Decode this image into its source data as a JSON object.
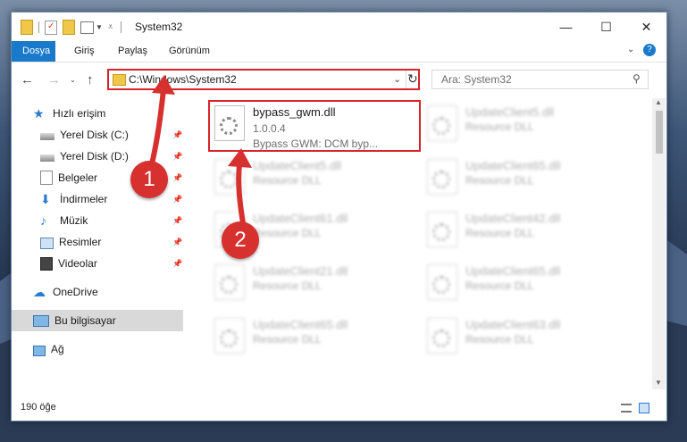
{
  "window": {
    "title": "System32",
    "minimize_glyph": "—",
    "maximize_glyph": "☐",
    "close_glyph": "✕"
  },
  "ribbon": {
    "tabs": [
      "Dosya",
      "Giriş",
      "Paylaş",
      "Görünüm"
    ],
    "help_glyph": "?"
  },
  "address": {
    "path": "C:\\Windows\\System32",
    "search_placeholder": "Ara: System32"
  },
  "sidebar": {
    "items": [
      {
        "label": "Hızlı erişim",
        "icon": "star-icon"
      },
      {
        "label": "Yerel Disk (C:)",
        "icon": "drive-icon",
        "pinned": true
      },
      {
        "label": "Yerel Disk (D:)",
        "icon": "drive-icon",
        "pinned": true
      },
      {
        "label": "Belgeler",
        "icon": "documents-icon",
        "pinned": true
      },
      {
        "label": "İndirmeler",
        "icon": "download-icon",
        "pinned": true
      },
      {
        "label": "Müzik",
        "icon": "music-icon",
        "pinned": true
      },
      {
        "label": "Resimler",
        "icon": "pictures-icon",
        "pinned": true
      },
      {
        "label": "Videolar",
        "icon": "video-icon",
        "pinned": true
      },
      {
        "label": "OneDrive",
        "icon": "cloud-icon"
      },
      {
        "label": "Bu bilgisayar",
        "icon": "computer-icon",
        "selected": true
      },
      {
        "label": "Ağ",
        "icon": "network-icon"
      }
    ]
  },
  "files": [
    {
      "name": "bypass_gwm.dll",
      "line2": "1.0.0.4",
      "line3": "Bypass GWM: DCM byp...",
      "highlighted": true
    },
    {
      "name": "UpdateClient5.dll",
      "line2": "Resource DLL"
    },
    {
      "name": "UpdateClient5.dll",
      "line2": "Resource DLL"
    },
    {
      "name": "UpdateClient65.dll",
      "line2": "Resource DLL"
    },
    {
      "name": "UpdateClient61.dll",
      "line2": "Resource DLL"
    },
    {
      "name": "UpdateClient42.dll",
      "line2": "Resource DLL"
    },
    {
      "name": "UpdateClient21.dll",
      "line2": "Resource DLL"
    },
    {
      "name": "UpdateClient65.dll",
      "line2": "Resource DLL"
    },
    {
      "name": "UpdateClient65.dll",
      "line2": "Resource DLL"
    },
    {
      "name": "UpdateClient63.dll",
      "line2": "Resource DLL"
    }
  ],
  "status": {
    "item_count": "190 öğe"
  },
  "annotations": {
    "badge1": "1",
    "badge2": "2"
  },
  "colors": {
    "accent": "#1979ca",
    "highlight": "#d9232a",
    "badge": "#d6302f"
  }
}
